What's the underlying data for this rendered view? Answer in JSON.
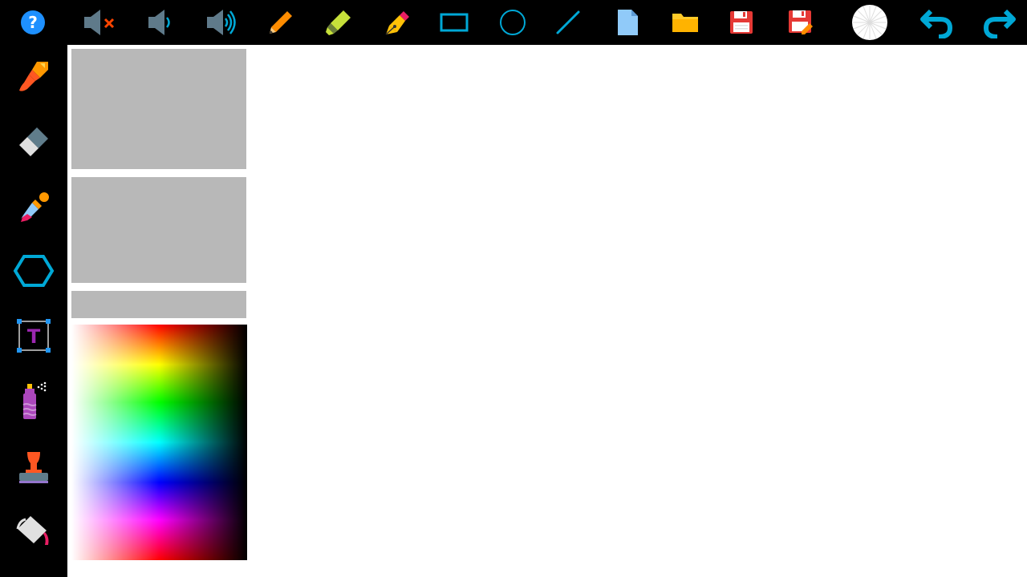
{
  "app": {
    "name": "drawing-app",
    "accent": "#00a8d6",
    "topbar_bg": "#000000",
    "sidebar_bg": "#000000",
    "canvas_bg": "#ffffff",
    "panel_color": "#b8b8b8"
  },
  "toolbar": {
    "items": [
      {
        "name": "help",
        "icon": "help-icon",
        "color": "#1e90ff"
      },
      {
        "name": "mute",
        "icon": "mute-icon",
        "color": "#ff4500"
      },
      {
        "name": "volume-low",
        "icon": "volume-low-icon",
        "color": "#00a8d6"
      },
      {
        "name": "volume-high",
        "icon": "volume-high-icon",
        "color": "#00a8d6"
      },
      {
        "name": "pencil",
        "icon": "pencil-icon",
        "color": "#ff8c00"
      },
      {
        "name": "highlighter",
        "icon": "highlighter-icon",
        "color": "#c6e03a"
      },
      {
        "name": "fountain-pen",
        "icon": "fountain-pen-icon",
        "color": "#ffc107"
      },
      {
        "name": "rectangle",
        "icon": "rectangle-icon",
        "color": "#00a8d6"
      },
      {
        "name": "circle",
        "icon": "circle-icon",
        "color": "#00a8d6"
      },
      {
        "name": "line",
        "icon": "line-icon",
        "color": "#00a8d6"
      },
      {
        "name": "new-file",
        "icon": "new-file-icon",
        "color": "#90caf9"
      },
      {
        "name": "open-folder",
        "icon": "folder-icon",
        "color": "#ffca28"
      },
      {
        "name": "save",
        "icon": "save-icon",
        "color": "#e53935"
      },
      {
        "name": "save-as",
        "icon": "save-as-icon",
        "color": "#e53935"
      },
      {
        "name": "brush-size",
        "icon": "brush-size-icon",
        "color": "#ffffff"
      },
      {
        "name": "undo",
        "icon": "undo-icon",
        "color": "#00a8d6"
      },
      {
        "name": "redo",
        "icon": "redo-icon",
        "color": "#00a8d6"
      }
    ]
  },
  "sidebar": {
    "items": [
      {
        "name": "brush",
        "icon": "paintbrush-icon"
      },
      {
        "name": "eraser",
        "icon": "eraser-icon"
      },
      {
        "name": "eyedropper",
        "icon": "eyedropper-icon"
      },
      {
        "name": "polygon",
        "icon": "hexagon-icon"
      },
      {
        "name": "text",
        "icon": "text-tool-icon",
        "glyph": "T"
      },
      {
        "name": "spray",
        "icon": "spray-can-icon"
      },
      {
        "name": "stamp",
        "icon": "stamp-icon"
      },
      {
        "name": "fill",
        "icon": "paint-bucket-icon"
      }
    ]
  }
}
